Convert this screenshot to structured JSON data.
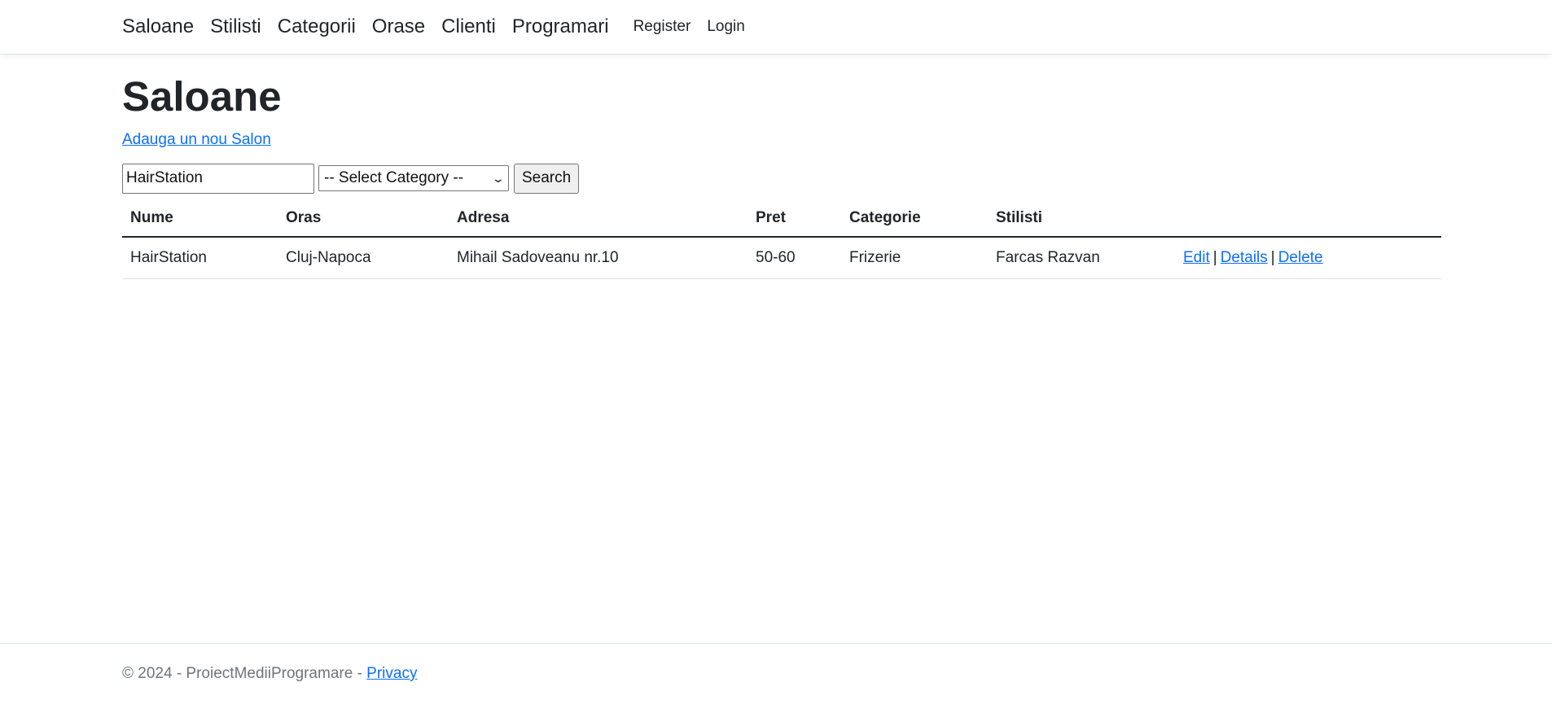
{
  "nav": {
    "items": [
      {
        "label": "Saloane"
      },
      {
        "label": "Stilisti"
      },
      {
        "label": "Categorii"
      },
      {
        "label": "Orase"
      },
      {
        "label": "Clienti"
      },
      {
        "label": "Programari"
      }
    ],
    "register": "Register",
    "login": "Login"
  },
  "page": {
    "title": "Saloane",
    "create_link": "Adauga un nou Salon"
  },
  "search": {
    "value": "HairStation",
    "category_selected": "-- Select Category --",
    "button": "Search"
  },
  "table": {
    "headers": [
      "Nume",
      "Oras",
      "Adresa",
      "Pret",
      "Categorie",
      "Stilisti",
      ""
    ],
    "rows": [
      {
        "nume": "HairStation",
        "oras": "Cluj-Napoca",
        "adresa": "Mihail Sadoveanu nr.10",
        "pret": "50-60",
        "categorie": "Frizerie",
        "stilisti": "Farcas Razvan",
        "edit": "Edit",
        "details": "Details",
        "delete": "Delete"
      }
    ],
    "separator": "|"
  },
  "footer": {
    "text": "© 2024 - ProiectMediiProgramare - ",
    "privacy": "Privacy"
  },
  "colors": {
    "link": "#0d6efd",
    "text": "#212529",
    "muted": "#6c757d",
    "border": "#dee2e6"
  }
}
